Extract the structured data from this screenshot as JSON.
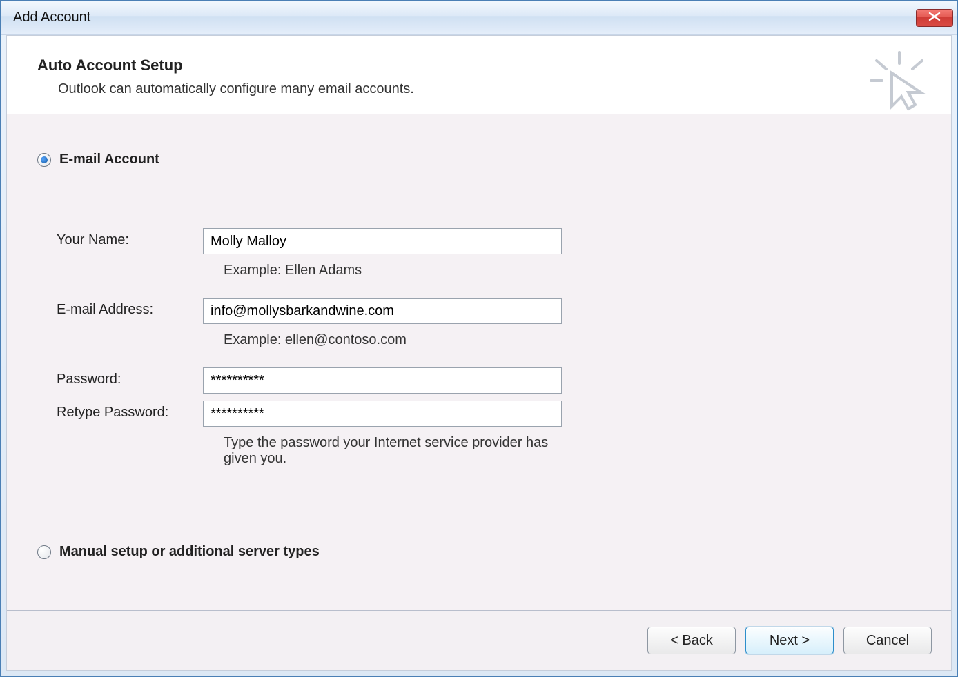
{
  "window": {
    "title": "Add Account"
  },
  "header": {
    "title": "Auto Account Setup",
    "subtitle": "Outlook can automatically configure many email accounts."
  },
  "radios": {
    "email_account": "E-mail Account",
    "manual": "Manual setup or additional server types"
  },
  "fields": {
    "name_label": "Your Name:",
    "name_value": "Molly Malloy",
    "name_hint": "Example: Ellen Adams",
    "email_label": "E-mail Address:",
    "email_value": "info@mollysbarkandwine.com",
    "email_hint": "Example: ellen@contoso.com",
    "password_label": "Password:",
    "password_value": "**********",
    "retype_label": "Retype Password:",
    "retype_value": "**********",
    "password_hint": "Type the password your Internet service provider has given you."
  },
  "buttons": {
    "back": "< Back",
    "next": "Next >",
    "cancel": "Cancel"
  }
}
